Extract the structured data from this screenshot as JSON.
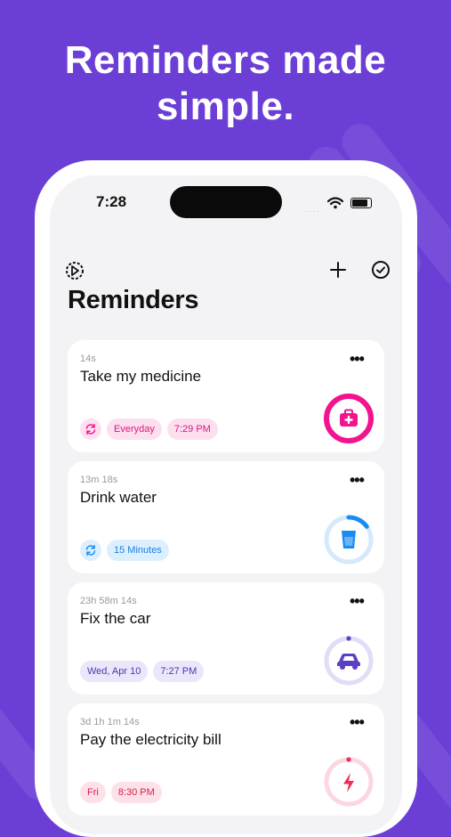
{
  "headline": "Reminders made simple.",
  "status_bar": {
    "time": "7:28",
    "signal": "····"
  },
  "toolbar": {
    "settings_icon": "gear-icon",
    "add_icon": "plus-icon",
    "done_icon": "check-circle-icon"
  },
  "page_title": "Reminders",
  "reminders": [
    {
      "elapsed": "14s",
      "name": "Take my medicine",
      "repeat_icon": "repeat-icon",
      "chips": [
        "Everyday",
        "7:29 PM"
      ],
      "icon": "medical-kit-icon",
      "accent": "#f2138e",
      "chip_bg": "#fde0ef",
      "progress": 1.0
    },
    {
      "elapsed": "13m 18s",
      "name": "Drink water",
      "repeat_icon": "repeat-icon",
      "chips": [
        "15 Minutes"
      ],
      "icon": "glass-icon",
      "accent": "#1a8cf0",
      "chip_bg": "#dcefff",
      "progress": 0.15
    },
    {
      "elapsed": "23h 58m 14s",
      "name": "Fix the car",
      "chips": [
        "Wed, Apr 10",
        "7:27 PM"
      ],
      "icon": "car-icon",
      "accent": "#5b3fc4",
      "chip_bg": "#ebe6fa",
      "progress": 0.0
    },
    {
      "elapsed": "3d 1h 1m 14s",
      "name": "Pay the electricity bill",
      "chips": [
        "Fri",
        "8:30 PM"
      ],
      "icon": "lightning-icon",
      "accent": "#ee2e5b",
      "chip_bg": "#fde1e8",
      "progress": 0.0
    }
  ]
}
